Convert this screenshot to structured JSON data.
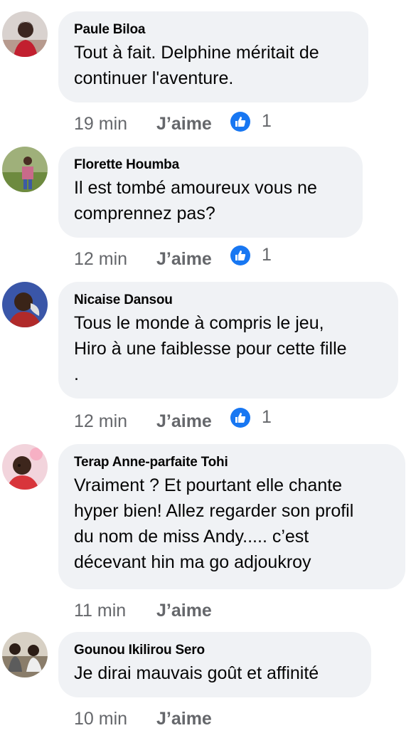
{
  "like_label": "J’aime",
  "colors": {
    "bubble": "#f0f2f5",
    "meta_text": "#65676b",
    "like_blue": "#1877f2"
  },
  "comments": [
    {
      "author": "Paule Biloa",
      "text": "Tout à fait. Delphine méritait de\ncontinuer l'aventure.",
      "time": "19 min",
      "reactions": {
        "icon": "thumbs-up-icon",
        "count": "1"
      }
    },
    {
      "author": "Florette Houmba",
      "text": "Il est tombé amoureux vous ne\ncomprennez pas?",
      "time": "12 min",
      "reactions": {
        "icon": "thumbs-up-icon",
        "count": "1"
      }
    },
    {
      "author": "Nicaise Dansou",
      "text": "Tous le monde à compris le jeu,\nHiro à une faiblesse pour cette fille\n.",
      "time": "12 min",
      "reactions": {
        "icon": "thumbs-up-icon",
        "count": "1"
      }
    },
    {
      "author": "Terap Anne-parfaite Tohi",
      "text": "Vraiment ? Et pourtant elle chante\nhyper bien! Allez regarder son profil\ndu nom de miss Andy..... c’est\ndécevant hin ma go adjoukroy",
      "time": "11 min"
    },
    {
      "author": "Gounou Ikilirou Sero",
      "text": "Je dirai mauvais goût et affinité",
      "time": "10 min"
    }
  ]
}
